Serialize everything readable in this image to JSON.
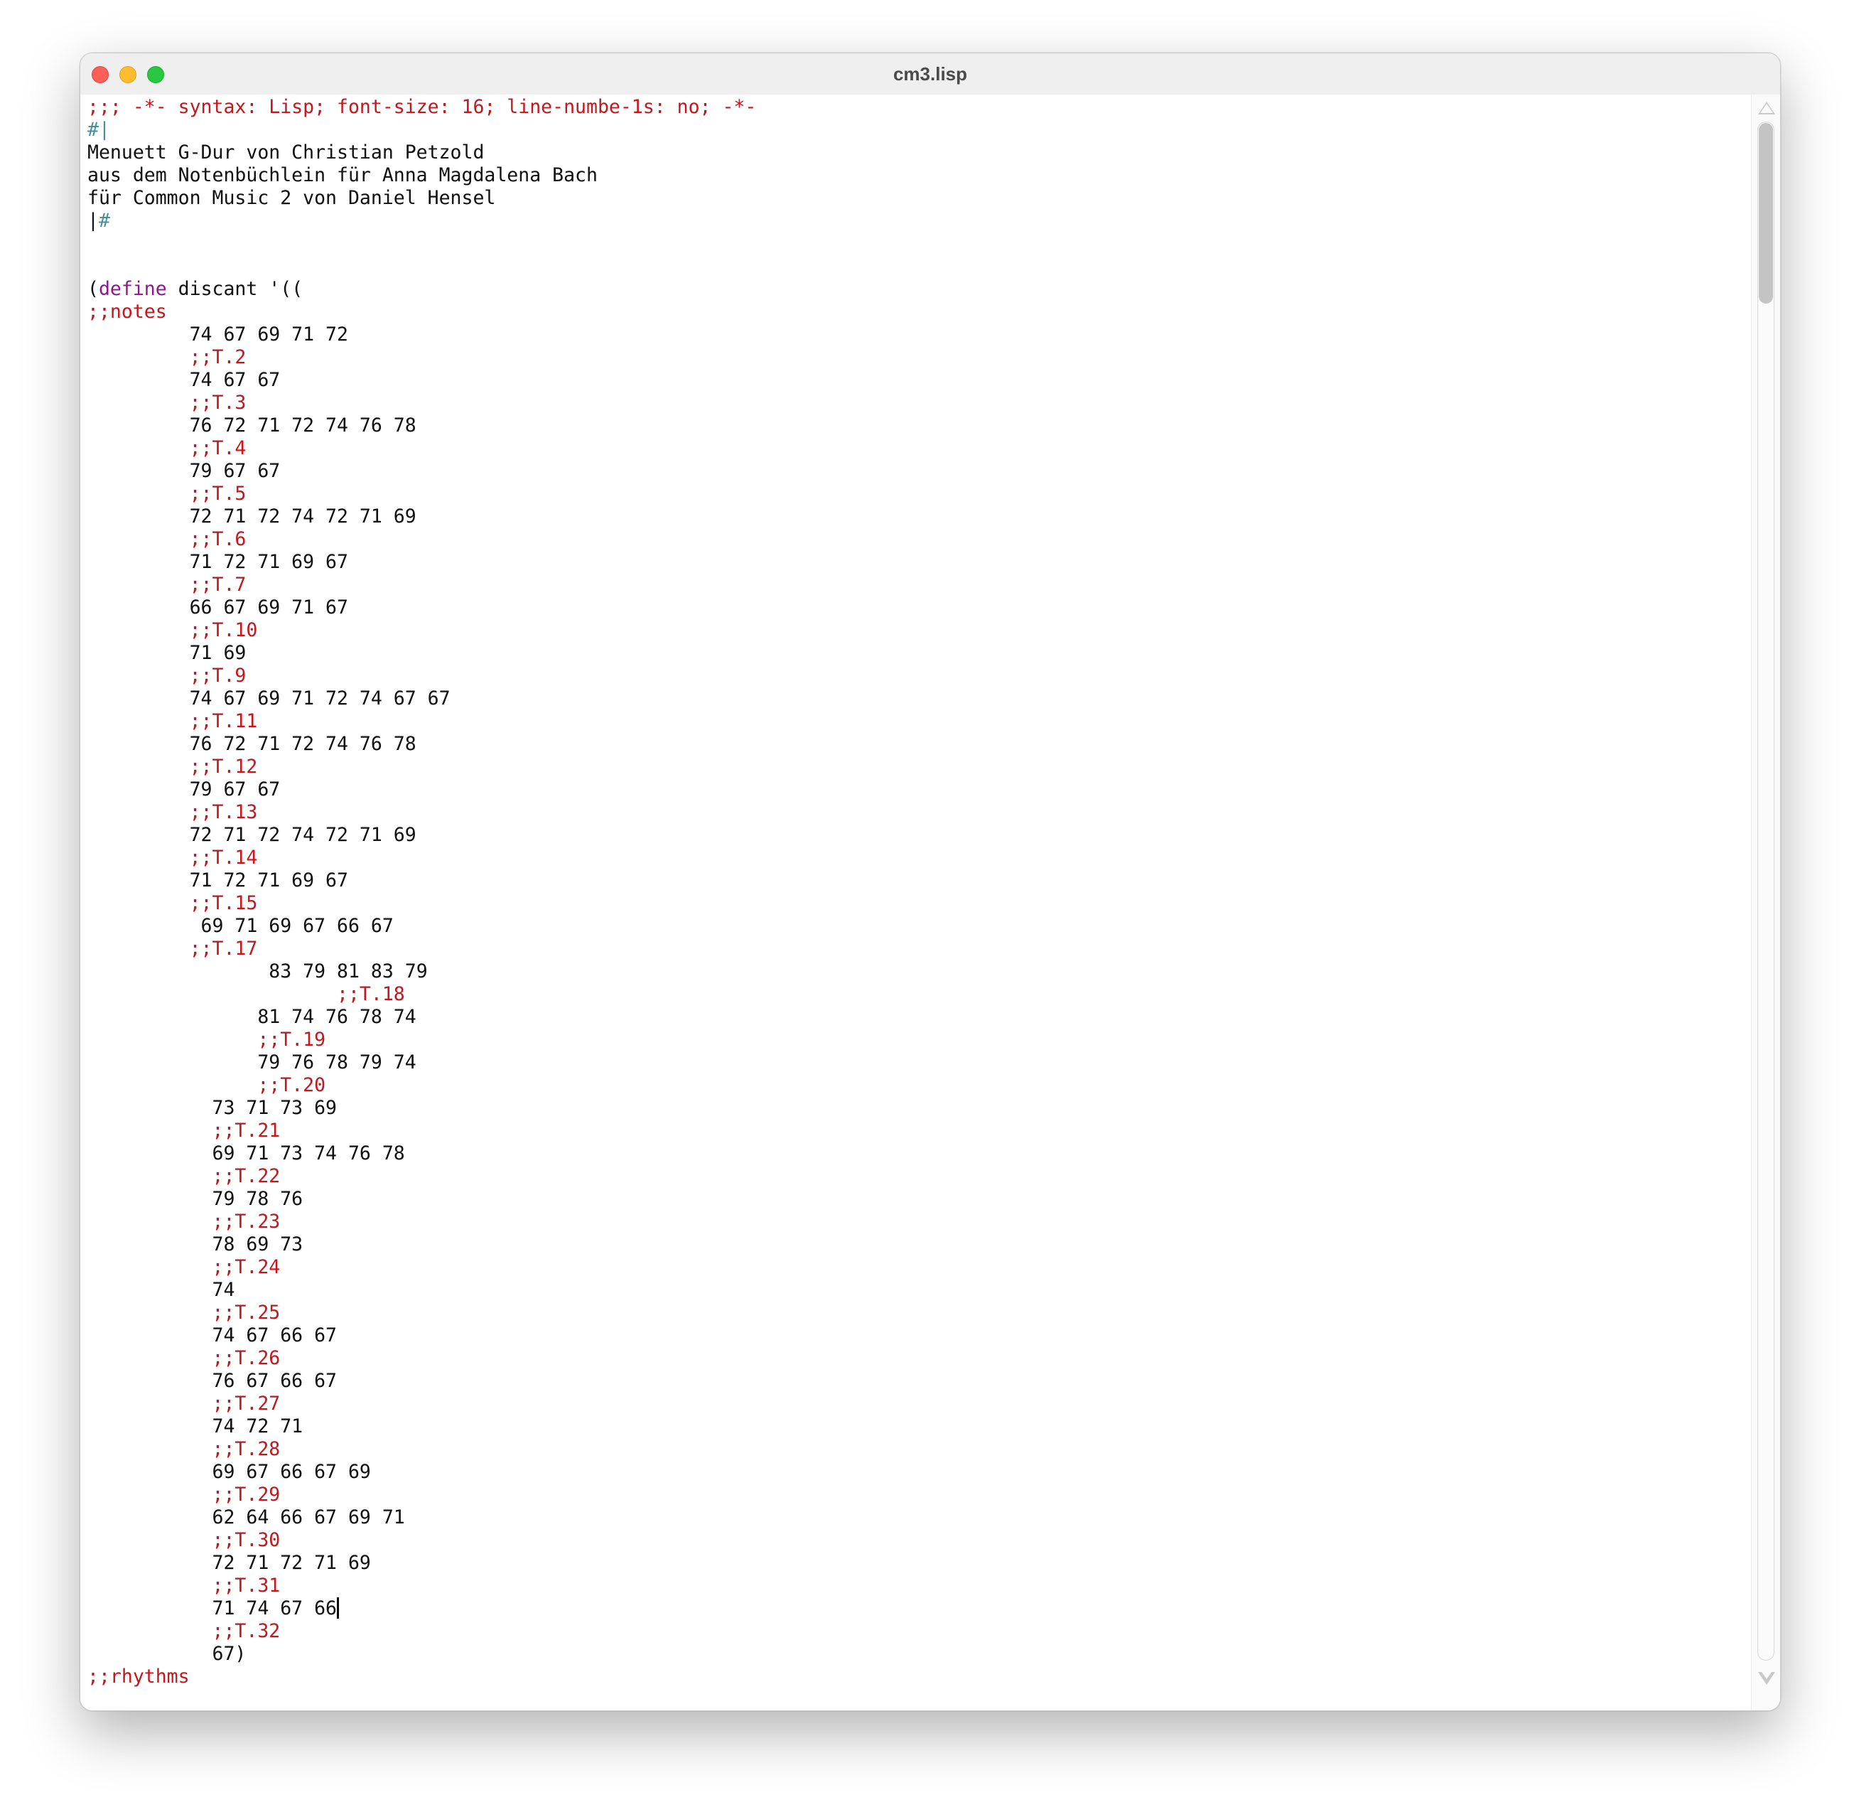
{
  "window": {
    "title": "cm3.lisp"
  },
  "editor": {
    "lines": [
      {
        "indent": "",
        "parts": [
          {
            "t": ";;; -*- syntax: Lisp; font-size: 16; line-numbe-1s: no; -*-",
            "k": "comment"
          }
        ]
      },
      {
        "indent": "",
        "parts": [
          {
            "t": "#|",
            "k": "block"
          }
        ]
      },
      {
        "indent": "",
        "parts": [
          {
            "t": "Menuett G-Dur von Christian Petzold",
            "k": "text"
          }
        ]
      },
      {
        "indent": "",
        "parts": [
          {
            "t": "aus dem Notenbüchlein für Anna Magdalena Bach",
            "k": "text"
          }
        ]
      },
      {
        "indent": "",
        "parts": [
          {
            "t": "für Common Music 2 von Daniel Hensel",
            "k": "text"
          }
        ]
      },
      {
        "indent": "",
        "parts": [
          {
            "t": "|",
            "k": "text"
          },
          {
            "t": "#",
            "k": "block"
          }
        ]
      },
      {
        "indent": "",
        "parts": []
      },
      {
        "indent": "",
        "parts": []
      },
      {
        "indent": "",
        "parts": [
          {
            "t": "(",
            "k": "text"
          },
          {
            "t": "define",
            "k": "keyword"
          },
          {
            "t": " discant '((",
            "k": "text"
          }
        ]
      },
      {
        "indent": "",
        "parts": [
          {
            "t": ";;notes",
            "k": "comment"
          }
        ]
      },
      {
        "indent": "         ",
        "parts": [
          {
            "t": "74 67 69 71 72",
            "k": "text"
          }
        ]
      },
      {
        "indent": "         ",
        "parts": [
          {
            "t": ";;T.2",
            "k": "comment"
          }
        ]
      },
      {
        "indent": "         ",
        "parts": [
          {
            "t": "74 67 67",
            "k": "text"
          }
        ]
      },
      {
        "indent": "         ",
        "parts": [
          {
            "t": ";;T.3",
            "k": "comment"
          }
        ]
      },
      {
        "indent": "         ",
        "parts": [
          {
            "t": "76 72 71 72 74 76 78",
            "k": "text"
          }
        ]
      },
      {
        "indent": "         ",
        "parts": [
          {
            "t": ";;T.4",
            "k": "comment"
          }
        ]
      },
      {
        "indent": "         ",
        "parts": [
          {
            "t": "79 67 67",
            "k": "text"
          }
        ]
      },
      {
        "indent": "         ",
        "parts": [
          {
            "t": ";;T.5",
            "k": "comment"
          }
        ]
      },
      {
        "indent": "         ",
        "parts": [
          {
            "t": "72 71 72 74 72 71 69",
            "k": "text"
          }
        ]
      },
      {
        "indent": "         ",
        "parts": [
          {
            "t": ";;T.6",
            "k": "comment"
          }
        ]
      },
      {
        "indent": "         ",
        "parts": [
          {
            "t": "71 72 71 69 67",
            "k": "text"
          }
        ]
      },
      {
        "indent": "         ",
        "parts": [
          {
            "t": ";;T.7",
            "k": "comment"
          }
        ]
      },
      {
        "indent": "         ",
        "parts": [
          {
            "t": "66 67 69 71 67",
            "k": "text"
          }
        ]
      },
      {
        "indent": "         ",
        "parts": [
          {
            "t": ";;T.10",
            "k": "comment"
          }
        ]
      },
      {
        "indent": "         ",
        "parts": [
          {
            "t": "71 69",
            "k": "text"
          }
        ]
      },
      {
        "indent": "         ",
        "parts": [
          {
            "t": ";;T.9",
            "k": "comment"
          }
        ]
      },
      {
        "indent": "         ",
        "parts": [
          {
            "t": "74 67 69 71 72 74 67 67",
            "k": "text"
          }
        ]
      },
      {
        "indent": "         ",
        "parts": [
          {
            "t": ";;T.11",
            "k": "comment"
          }
        ]
      },
      {
        "indent": "         ",
        "parts": [
          {
            "t": "76 72 71 72 74 76 78",
            "k": "text"
          }
        ]
      },
      {
        "indent": "         ",
        "parts": [
          {
            "t": ";;T.12",
            "k": "comment"
          }
        ]
      },
      {
        "indent": "         ",
        "parts": [
          {
            "t": "79 67 67",
            "k": "text"
          }
        ]
      },
      {
        "indent": "         ",
        "parts": [
          {
            "t": ";;T.13",
            "k": "comment"
          }
        ]
      },
      {
        "indent": "         ",
        "parts": [
          {
            "t": "72 71 72 74 72 71 69",
            "k": "text"
          }
        ]
      },
      {
        "indent": "         ",
        "parts": [
          {
            "t": ";;T.14",
            "k": "comment"
          }
        ]
      },
      {
        "indent": "         ",
        "parts": [
          {
            "t": "71 72 71 69 67",
            "k": "text"
          }
        ]
      },
      {
        "indent": "         ",
        "parts": [
          {
            "t": ";;T.15",
            "k": "comment"
          }
        ]
      },
      {
        "indent": "          ",
        "parts": [
          {
            "t": "69 71 69 67 66 67",
            "k": "text"
          }
        ]
      },
      {
        "indent": "         ",
        "parts": [
          {
            "t": ";;T.17",
            "k": "comment"
          }
        ]
      },
      {
        "indent": "                ",
        "parts": [
          {
            "t": "83 79 81 83 79",
            "k": "text"
          }
        ]
      },
      {
        "indent": "                      ",
        "parts": [
          {
            "t": ";;T.18",
            "k": "comment"
          }
        ]
      },
      {
        "indent": "               ",
        "parts": [
          {
            "t": "81 74 76 78 74",
            "k": "text"
          }
        ]
      },
      {
        "indent": "               ",
        "parts": [
          {
            "t": ";;T.19",
            "k": "comment"
          }
        ]
      },
      {
        "indent": "               ",
        "parts": [
          {
            "t": "79 76 78 79 74",
            "k": "text"
          }
        ]
      },
      {
        "indent": "               ",
        "parts": [
          {
            "t": ";;T.20",
            "k": "comment"
          }
        ]
      },
      {
        "indent": "           ",
        "parts": [
          {
            "t": "73 71 73 69",
            "k": "text"
          }
        ]
      },
      {
        "indent": "           ",
        "parts": [
          {
            "t": ";;T.21",
            "k": "comment"
          }
        ]
      },
      {
        "indent": "           ",
        "parts": [
          {
            "t": "69 71 73 74 76 78",
            "k": "text"
          }
        ]
      },
      {
        "indent": "           ",
        "parts": [
          {
            "t": ";;T.22",
            "k": "comment"
          }
        ]
      },
      {
        "indent": "           ",
        "parts": [
          {
            "t": "79 78 76",
            "k": "text"
          }
        ]
      },
      {
        "indent": "           ",
        "parts": [
          {
            "t": ";;T.23",
            "k": "comment"
          }
        ]
      },
      {
        "indent": "           ",
        "parts": [
          {
            "t": "78 69 73",
            "k": "text"
          }
        ]
      },
      {
        "indent": "           ",
        "parts": [
          {
            "t": ";;T.24",
            "k": "comment"
          }
        ]
      },
      {
        "indent": "           ",
        "parts": [
          {
            "t": "74",
            "k": "text"
          }
        ]
      },
      {
        "indent": "           ",
        "parts": [
          {
            "t": ";;T.25",
            "k": "comment"
          }
        ]
      },
      {
        "indent": "           ",
        "parts": [
          {
            "t": "74 67 66 67",
            "k": "text"
          }
        ]
      },
      {
        "indent": "           ",
        "parts": [
          {
            "t": ";;T.26",
            "k": "comment"
          }
        ]
      },
      {
        "indent": "           ",
        "parts": [
          {
            "t": "76 67 66 67",
            "k": "text"
          }
        ]
      },
      {
        "indent": "           ",
        "parts": [
          {
            "t": ";;T.27",
            "k": "comment"
          }
        ]
      },
      {
        "indent": "           ",
        "parts": [
          {
            "t": "74 72 71",
            "k": "text"
          }
        ]
      },
      {
        "indent": "           ",
        "parts": [
          {
            "t": ";;T.28",
            "k": "comment"
          }
        ]
      },
      {
        "indent": "           ",
        "parts": [
          {
            "t": "69 67 66 67 69",
            "k": "text"
          }
        ]
      },
      {
        "indent": "           ",
        "parts": [
          {
            "t": ";;T.29",
            "k": "comment"
          }
        ]
      },
      {
        "indent": "           ",
        "parts": [
          {
            "t": "62 64 66 67 69 71",
            "k": "text"
          }
        ]
      },
      {
        "indent": "           ",
        "parts": [
          {
            "t": ";;T.30",
            "k": "comment"
          }
        ]
      },
      {
        "indent": "           ",
        "parts": [
          {
            "t": "72 71 72 71 69",
            "k": "text"
          }
        ]
      },
      {
        "indent": "           ",
        "parts": [
          {
            "t": ";;T.31",
            "k": "comment"
          }
        ]
      },
      {
        "indent": "           ",
        "parts": [
          {
            "t": "71 74 67 66",
            "k": "text"
          },
          {
            "t": "",
            "k": "caret"
          }
        ]
      },
      {
        "indent": "           ",
        "parts": [
          {
            "t": ";;T.32",
            "k": "comment"
          }
        ]
      },
      {
        "indent": "           ",
        "parts": [
          {
            "t": "67)",
            "k": "text"
          }
        ]
      },
      {
        "indent": "",
        "parts": [
          {
            "t": ";;rhythms",
            "k": "comment"
          }
        ]
      }
    ]
  },
  "colors": {
    "comment": "#c4161c",
    "block_comment": "#4a8f96",
    "keyword": "#8b1a89",
    "text": "#111111"
  },
  "icons": {
    "close": "close-icon",
    "minimize": "minimize-icon",
    "maximize": "maximize-icon",
    "scroll_up": "triangle-up-icon",
    "scroll_down": "triangle-down-icon"
  }
}
